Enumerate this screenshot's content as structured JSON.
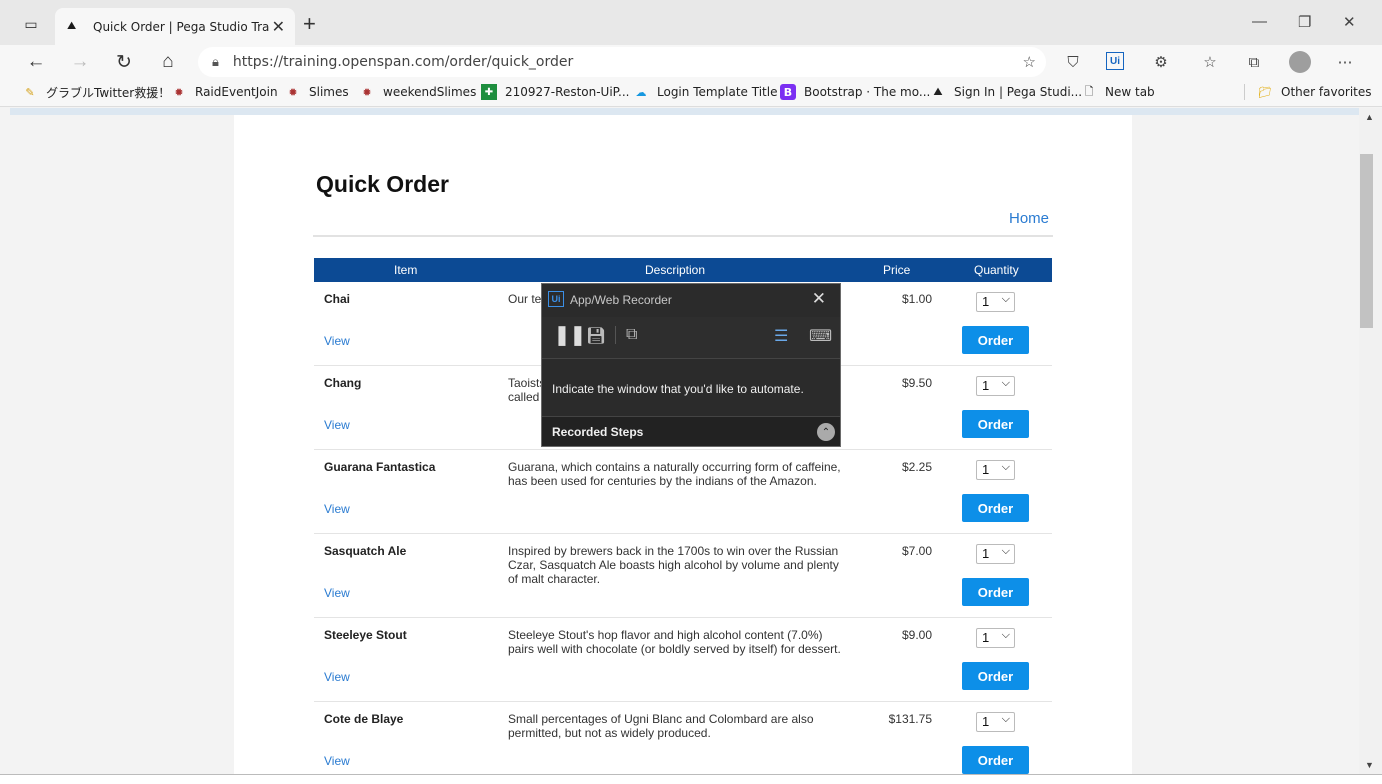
{
  "browser": {
    "tab_title": "Quick Order | Pega Studio Trainin",
    "url": "https://training.openspan.com/order/quick_order",
    "bookmarks": [
      {
        "label": "グラブルTwitter救援！",
        "icon": "bookmark-icon"
      },
      {
        "label": "RaidEventJoin",
        "icon": "bookmark-icon"
      },
      {
        "label": "Slimes",
        "icon": "bookmark-icon"
      },
      {
        "label": "weekendSlimes",
        "icon": "bookmark-icon"
      },
      {
        "label": "210927-Reston-UiP...",
        "icon": "bookmark-icon"
      },
      {
        "label": "Login Template Title",
        "icon": "bookmark-icon"
      },
      {
        "label": "Bootstrap · The mo...",
        "icon": "bookmark-icon"
      },
      {
        "label": "Sign In | Pega Studi...",
        "icon": "bookmark-icon"
      },
      {
        "label": "New tab",
        "icon": "page-icon"
      }
    ],
    "other_favorites": "Other favorites"
  },
  "page": {
    "title": "Quick Order",
    "home_link": "Home",
    "columns": [
      "Item",
      "Description",
      "Price",
      "Quantity"
    ],
    "view_label": "View",
    "order_label": "Order",
    "items": [
      {
        "name": "Chai",
        "description": "Our te",
        "price": "$1.00",
        "qty": "1"
      },
      {
        "name": "Chang",
        "description": "Taoists\ncalled",
        "price": "$9.50",
        "qty": "1"
      },
      {
        "name": "Guarana Fantastica",
        "description": "Guarana, which contains a naturally occurring form of caffeine, has been used for centuries by the indians of the Amazon.",
        "price": "$2.25",
        "qty": "1"
      },
      {
        "name": "Sasquatch Ale",
        "description": "Inspired by brewers back in the 1700s to win over the Russian Czar, Sasquatch Ale boasts high alcohol by volume and plenty of malt character.",
        "price": "$7.00",
        "qty": "1"
      },
      {
        "name": "Steeleye Stout",
        "description": "Steeleye Stout's hop flavor and high alcohol content (7.0%) pairs well with chocolate (or boldly served by itself) for dessert.",
        "price": "$9.00",
        "qty": "1"
      },
      {
        "name": "Cote de Blaye",
        "description": "Small percentages of Ugni Blanc and Colombard are also permitted, but not as widely produced.",
        "price": "$131.75",
        "qty": "1"
      }
    ]
  },
  "recorder": {
    "logo": "Ui",
    "title": "App/Web Recorder",
    "message": "Indicate the window that you'd like to automate.",
    "steps_label": "Recorded Steps"
  },
  "colors": {
    "header_bg": "#0c4a94",
    "order_btn": "#0d8fe8",
    "link": "#2a7bd1"
  }
}
